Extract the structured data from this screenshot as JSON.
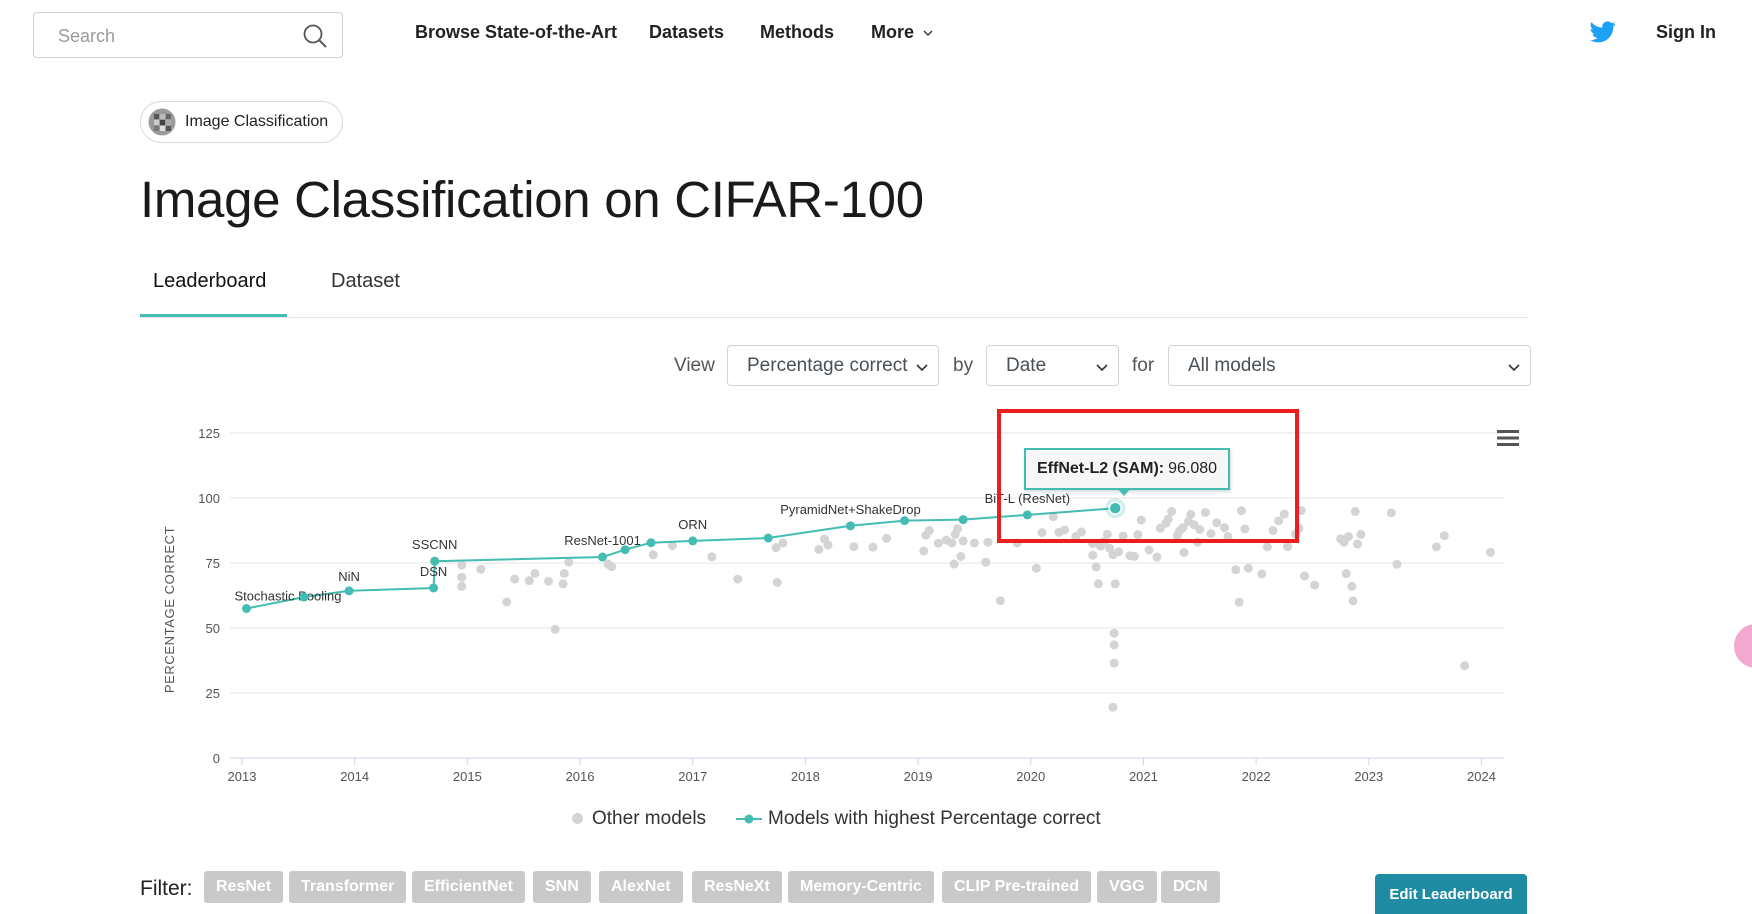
{
  "nav": {
    "search_placeholder": "Search",
    "links": [
      "Browse State-of-the-Art",
      "Datasets",
      "Methods",
      "More"
    ],
    "sign_in": "Sign In"
  },
  "task_chip": {
    "label": "Image Classification"
  },
  "page_title": "Image Classification on CIFAR-100",
  "tabs": [
    {
      "label": "Leaderboard",
      "active": true
    },
    {
      "label": "Dataset",
      "active": false
    }
  ],
  "view_bar": {
    "view_label": "View",
    "by_label": "by",
    "for_label": "for",
    "metric_selected": "Percentage correct",
    "x_selected": "Date",
    "models_selected": "All models"
  },
  "tooltip": {
    "model": "EffNet-L2 (SAM):",
    "value": "96.080"
  },
  "legend": {
    "other": "Other models",
    "best": "Models with highest Percentage correct"
  },
  "filter": {
    "label": "Filter:",
    "tags": [
      "ResNet",
      "Transformer",
      "EfficientNet",
      "SNN",
      "AlexNet",
      "ResNeXt",
      "Memory-Centric",
      "CLIP Pre-trained",
      "VGG",
      "DCN"
    ]
  },
  "edit_button": "Edit Leaderboard",
  "colors": {
    "accent": "#43bdb2",
    "other_points": "#d4d4d4",
    "highlight": "#ee1c1c",
    "edit_button": "#1f8ca3",
    "tag": "#c9c9c9"
  },
  "chart_data": {
    "type": "scatter",
    "ylabel": "PERCENTAGE CORRECT",
    "xlabel": "",
    "xlim": [
      2013.0,
      2024.2
    ],
    "ylim": [
      0,
      125
    ],
    "yticks": [
      0,
      25,
      50,
      75,
      100,
      125
    ],
    "xticks": [
      2013,
      2014,
      2015,
      2016,
      2017,
      2018,
      2019,
      2020,
      2021,
      2022,
      2023,
      2024
    ],
    "grid": true,
    "legend_position": "bottom",
    "series": [
      {
        "name": "Models with highest Percentage correct",
        "mode": "line+markers",
        "points": [
          {
            "x": 2013.04,
            "y": 57.5,
            "label": "Stochastic Pooling"
          },
          {
            "x": 2013.55,
            "y": 61.9,
            "label": ""
          },
          {
            "x": 2013.95,
            "y": 64.3,
            "label": "NiN"
          },
          {
            "x": 2014.7,
            "y": 65.4,
            "label": "DSN"
          },
          {
            "x": 2014.71,
            "y": 75.7,
            "label": "SSCNN"
          },
          {
            "x": 2016.2,
            "y": 77.3,
            "label": "ResNet-1001"
          },
          {
            "x": 2016.4,
            "y": 80.1,
            "label": ""
          },
          {
            "x": 2016.63,
            "y": 82.8,
            "label": ""
          },
          {
            "x": 2017.0,
            "y": 83.5,
            "label": "ORN"
          },
          {
            "x": 2017.67,
            "y": 84.6,
            "label": ""
          },
          {
            "x": 2018.4,
            "y": 89.3,
            "label": "PyramidNet+ShakeDrop"
          },
          {
            "x": 2018.88,
            "y": 91.3,
            "label": ""
          },
          {
            "x": 2019.4,
            "y": 91.7,
            "label": ""
          },
          {
            "x": 2019.97,
            "y": 93.5,
            "label": "BiT-L (ResNet)"
          },
          {
            "x": 2020.75,
            "y": 96.08,
            "label": "EffNet-L2 (SAM)"
          }
        ]
      },
      {
        "name": "Other models",
        "mode": "markers",
        "points": [
          [
            2014.95,
            74.2
          ],
          [
            2014.95,
            69.5
          ],
          [
            2014.95,
            66.0
          ],
          [
            2015.12,
            72.6
          ],
          [
            2015.35,
            60.0
          ],
          [
            2015.42,
            68.8
          ],
          [
            2015.55,
            68.2
          ],
          [
            2015.6,
            71.0
          ],
          [
            2015.72,
            68.0
          ],
          [
            2015.78,
            49.5
          ],
          [
            2015.85,
            67.0
          ],
          [
            2015.86,
            71.0
          ],
          [
            2015.9,
            75.3
          ],
          [
            2016.25,
            74.5
          ],
          [
            2016.28,
            73.6
          ],
          [
            2016.65,
            78.2
          ],
          [
            2016.82,
            81.7
          ],
          [
            2017.17,
            77.4
          ],
          [
            2017.4,
            68.8
          ],
          [
            2017.75,
            67.5
          ],
          [
            2017.74,
            80.9
          ],
          [
            2017.8,
            82.7
          ],
          [
            2018.12,
            80.2
          ],
          [
            2018.17,
            84.2
          ],
          [
            2018.2,
            81.9
          ],
          [
            2018.43,
            81.3
          ],
          [
            2018.6,
            81.1
          ],
          [
            2018.72,
            84.5
          ],
          [
            2019.05,
            79.6
          ],
          [
            2019.07,
            85.7
          ],
          [
            2019.1,
            87.5
          ],
          [
            2019.18,
            82.6
          ],
          [
            2019.25,
            83.8
          ],
          [
            2019.3,
            82.7
          ],
          [
            2019.32,
            74.6
          ],
          [
            2019.33,
            86.0
          ],
          [
            2019.35,
            88.2
          ],
          [
            2019.38,
            77.5
          ],
          [
            2019.4,
            83.5
          ],
          [
            2019.5,
            82.7
          ],
          [
            2019.6,
            75.3
          ],
          [
            2019.62,
            83.0
          ],
          [
            2019.73,
            60.5
          ],
          [
            2019.88,
            82.7
          ],
          [
            2020.05,
            73.0
          ],
          [
            2020.1,
            86.7
          ],
          [
            2020.2,
            92.8
          ],
          [
            2020.25,
            86.8
          ],
          [
            2020.3,
            87.7
          ],
          [
            2020.4,
            85.2
          ],
          [
            2020.45,
            86.9
          ],
          [
            2020.55,
            82.5
          ],
          [
            2020.55,
            78.0
          ],
          [
            2020.58,
            73.5
          ],
          [
            2020.6,
            67.0
          ],
          [
            2020.62,
            81.5
          ],
          [
            2020.65,
            83.2
          ],
          [
            2020.68,
            86.0
          ],
          [
            2020.7,
            80.7
          ],
          [
            2020.73,
            78.2
          ],
          [
            2020.75,
            67.0
          ],
          [
            2020.74,
            48.0
          ],
          [
            2020.74,
            43.5
          ],
          [
            2020.74,
            36.5
          ],
          [
            2020.73,
            19.5
          ],
          [
            2020.78,
            79.3
          ],
          [
            2020.82,
            85.4
          ],
          [
            2020.88,
            77.8
          ],
          [
            2020.92,
            77.5
          ],
          [
            2020.95,
            85.9
          ],
          [
            2020.98,
            91.5
          ],
          [
            2021.05,
            80.0
          ],
          [
            2021.12,
            77.3
          ],
          [
            2021.15,
            88.4
          ],
          [
            2021.2,
            90.3
          ],
          [
            2021.22,
            91.8
          ],
          [
            2021.25,
            94.8
          ],
          [
            2021.3,
            85.5
          ],
          [
            2021.32,
            87.3
          ],
          [
            2021.35,
            88.6
          ],
          [
            2021.36,
            79.0
          ],
          [
            2021.4,
            91.0
          ],
          [
            2021.42,
            93.7
          ],
          [
            2021.45,
            89.7
          ],
          [
            2021.48,
            83.0
          ],
          [
            2021.5,
            87.9
          ],
          [
            2021.55,
            94.4
          ],
          [
            2021.6,
            86.3
          ],
          [
            2021.65,
            90.5
          ],
          [
            2021.72,
            88.6
          ],
          [
            2021.75,
            85.2
          ],
          [
            2021.82,
            72.4
          ],
          [
            2021.85,
            59.9
          ],
          [
            2021.87,
            95.1
          ],
          [
            2021.9,
            88.1
          ],
          [
            2021.93,
            73.0
          ],
          [
            2022.05,
            70.8
          ],
          [
            2022.1,
            81.2
          ],
          [
            2022.15,
            87.5
          ],
          [
            2022.2,
            91.2
          ],
          [
            2022.25,
            93.8
          ],
          [
            2022.28,
            81.3
          ],
          [
            2022.35,
            86.1
          ],
          [
            2022.38,
            88.3
          ],
          [
            2022.4,
            95.2
          ],
          [
            2022.43,
            70.0
          ],
          [
            2022.52,
            66.5
          ],
          [
            2022.75,
            84.3
          ],
          [
            2022.78,
            83.0
          ],
          [
            2022.8,
            70.9
          ],
          [
            2022.82,
            85.2
          ],
          [
            2022.85,
            66.0
          ],
          [
            2022.86,
            60.4
          ],
          [
            2022.88,
            94.8
          ],
          [
            2022.9,
            82.3
          ],
          [
            2022.93,
            86.0
          ],
          [
            2023.2,
            94.3
          ],
          [
            2023.25,
            74.5
          ],
          [
            2023.6,
            81.2
          ],
          [
            2023.67,
            85.5
          ],
          [
            2023.85,
            35.5
          ],
          [
            2024.08,
            79.1
          ]
        ]
      }
    ]
  }
}
